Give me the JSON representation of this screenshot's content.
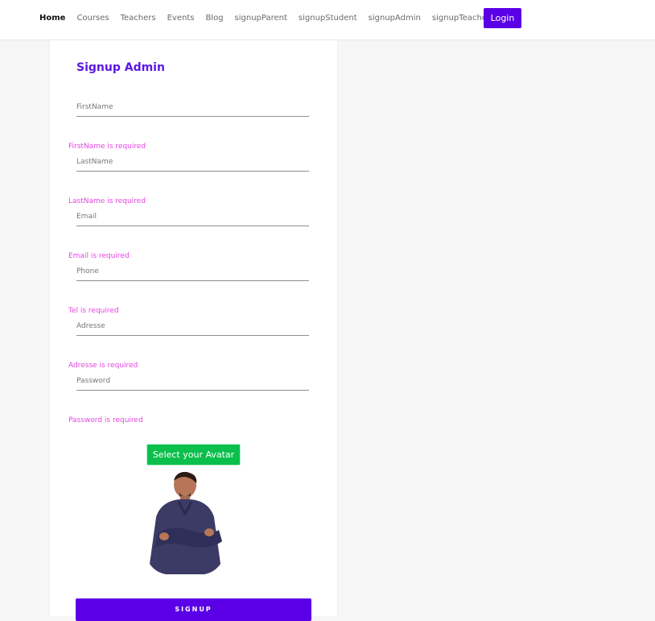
{
  "nav": {
    "links": [
      "Home",
      "Courses",
      "Teachers",
      "Events",
      "Blog",
      "signupParent",
      "signupStudent",
      "signupAdmin",
      "signupTeacher"
    ],
    "login_label": "Login"
  },
  "form": {
    "title": "Signup Admin",
    "fields": [
      {
        "placeholder": "FirstName",
        "error": "FirstName is required"
      },
      {
        "placeholder": "LastName",
        "error": "LastName is required"
      },
      {
        "placeholder": "Email",
        "error": "Email is required"
      },
      {
        "placeholder": "Phone",
        "error": "Tel is required"
      },
      {
        "placeholder": "Adresse",
        "error": "Adresse is required"
      },
      {
        "placeholder": "Password",
        "error": "Password is required"
      }
    ],
    "avatar_button_label": "Select your Avatar",
    "avatar_alt": "avatar",
    "submit_label": "SIGNUP"
  },
  "colors": {
    "brand": "#5b00e6",
    "title": "#5b18e6",
    "error": "#e545e2",
    "avatar_button": "#0bbf4c"
  },
  "icons": {
    "avatar": "avatar-image"
  }
}
